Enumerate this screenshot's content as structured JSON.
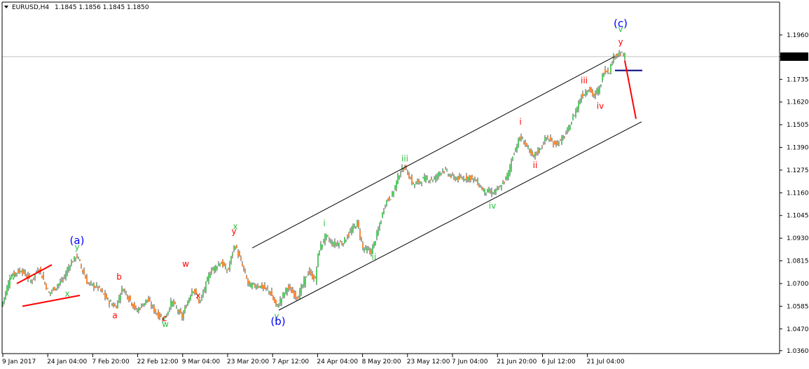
{
  "chart_data": {
    "type": "candlestick",
    "header": {
      "symbol_timeframe": "EURUSD,H4",
      "ohlc": "1.1845 1.1856 1.1845 1.1850"
    },
    "ylim": [
      1.0345,
      1.202
    ],
    "y_ticks": [
      "1.1960",
      "1.1850",
      "1.1735",
      "1.1620",
      "1.1505",
      "1.1390",
      "1.1275",
      "1.1160",
      "1.1045",
      "1.0930",
      "1.0815",
      "1.0700",
      "1.0585",
      "1.0470",
      "1.0360"
    ],
    "current_price": "1.1850",
    "x_ticks": [
      "9 Jan 2017",
      "24 Jan 04:00",
      "7 Feb 20:00",
      "22 Feb 12:00",
      "9 Mar 04:00",
      "23 Mar 20:00",
      "7 Apr 12:00",
      "24 Apr 04:00",
      "8 May 20:00",
      "23 May 12:00",
      "7 Jun 04:00",
      "21 Jun 20:00",
      "6 Jul 12:00",
      "21 Jul 04:00"
    ],
    "path": [
      [
        0,
        1.056
      ],
      [
        15,
        1.074
      ],
      [
        30,
        1.077
      ],
      [
        45,
        1.071
      ],
      [
        55,
        1.078
      ],
      [
        70,
        1.065
      ],
      [
        90,
        1.072
      ],
      [
        100,
        1.08
      ],
      [
        110,
        1.084
      ],
      [
        125,
        1.07
      ],
      [
        140,
        1.068
      ],
      [
        155,
        1.061
      ],
      [
        165,
        1.058
      ],
      [
        175,
        1.068
      ],
      [
        185,
        1.062
      ],
      [
        195,
        1.056
      ],
      [
        210,
        1.062
      ],
      [
        225,
        1.054
      ],
      [
        235,
        1.052
      ],
      [
        245,
        1.061
      ],
      [
        260,
        1.053
      ],
      [
        275,
        1.068
      ],
      [
        285,
        1.06
      ],
      [
        300,
        1.076
      ],
      [
        315,
        1.081
      ],
      [
        325,
        1.076
      ],
      [
        335,
        1.09
      ],
      [
        345,
        1.08
      ],
      [
        355,
        1.069
      ],
      [
        370,
        1.069
      ],
      [
        385,
        1.066
      ],
      [
        395,
        1.058
      ],
      [
        410,
        1.068
      ],
      [
        425,
        1.063
      ],
      [
        440,
        1.076
      ],
      [
        450,
        1.072
      ],
      [
        455,
        1.087
      ],
      [
        465,
        1.094
      ],
      [
        475,
        1.09
      ],
      [
        490,
        1.091
      ],
      [
        500,
        1.096
      ],
      [
        510,
        1.101
      ],
      [
        518,
        1.088
      ],
      [
        530,
        1.086
      ],
      [
        540,
        1.097
      ],
      [
        550,
        1.111
      ],
      [
        560,
        1.115
      ],
      [
        570,
        1.126
      ],
      [
        578,
        1.129
      ],
      [
        590,
        1.12
      ],
      [
        605,
        1.123
      ],
      [
        620,
        1.123
      ],
      [
        632,
        1.128
      ],
      [
        645,
        1.124
      ],
      [
        655,
        1.123
      ],
      [
        670,
        1.124
      ],
      [
        680,
        1.122
      ],
      [
        690,
        1.117
      ],
      [
        705,
        1.116
      ],
      [
        715,
        1.119
      ],
      [
        725,
        1.125
      ],
      [
        732,
        1.135
      ],
      [
        742,
        1.144
      ],
      [
        750,
        1.141
      ],
      [
        760,
        1.134
      ],
      [
        770,
        1.138
      ],
      [
        780,
        1.144
      ],
      [
        790,
        1.141
      ],
      [
        800,
        1.142
      ],
      [
        810,
        1.147
      ],
      [
        820,
        1.156
      ],
      [
        830,
        1.165
      ],
      [
        840,
        1.169
      ],
      [
        848,
        1.165
      ],
      [
        856,
        1.169
      ],
      [
        862,
        1.178
      ],
      [
        870,
        1.178
      ],
      [
        876,
        1.185
      ],
      [
        882,
        1.187
      ],
      [
        888,
        1.186
      ],
      [
        893,
        1.185
      ]
    ],
    "wave_labels": [
      {
        "text": "w",
        "color": "#2ec03f",
        "x": 17,
        "y": 1.072
      },
      {
        "text": "x",
        "color": "#2ec03f",
        "x": 96,
        "y": 1.0635
      },
      {
        "text": "(a)",
        "color": "#0000ff",
        "x": 110,
        "y": 1.09,
        "big": true
      },
      {
        "text": "y",
        "color": "#2ec03f",
        "x": 110,
        "y": 1.087
      },
      {
        "text": "b",
        "color": "#ff0000",
        "x": 170,
        "y": 1.072
      },
      {
        "text": "a",
        "color": "#ff0000",
        "x": 164,
        "y": 1.0525
      },
      {
        "text": "c",
        "color": "#ff0000",
        "x": 235,
        "y": 1.051
      },
      {
        "text": "w",
        "color": "#2ec03f",
        "x": 236,
        "y": 1.048
      },
      {
        "text": "w",
        "color": "#ff0000",
        "x": 265,
        "y": 1.0785
      },
      {
        "text": "x",
        "color": "#ff0000",
        "x": 283,
        "y": 1.0625
      },
      {
        "text": "x",
        "color": "#2ec03f",
        "x": 336,
        "y": 1.0975
      },
      {
        "text": "y",
        "color": "#ff0000",
        "x": 334,
        "y": 1.095
      },
      {
        "text": "y",
        "color": "#2ec03f",
        "x": 395,
        "y": 1.052
      },
      {
        "text": "(b)",
        "color": "#0000ff",
        "x": 397,
        "y": 1.049,
        "big": true
      },
      {
        "text": "i",
        "color": "#2ec03f",
        "x": 463,
        "y": 1.099
      },
      {
        "text": "ii",
        "color": "#2ec03f",
        "x": 534,
        "y": 1.082
      },
      {
        "text": "iii",
        "color": "#2ec03f",
        "x": 578,
        "y": 1.132
      },
      {
        "text": "iv",
        "color": "#2ec03f",
        "x": 703,
        "y": 1.108
      },
      {
        "text": "i",
        "color": "#ff0000",
        "x": 743,
        "y": 1.1505
      },
      {
        "text": "ii",
        "color": "#ff0000",
        "x": 764,
        "y": 1.1285
      },
      {
        "text": "iii",
        "color": "#ff0000",
        "x": 834,
        "y": 1.1715
      },
      {
        "text": "iv",
        "color": "#ff0000",
        "x": 857,
        "y": 1.1585
      },
      {
        "text": "v",
        "color": "#2ec03f",
        "x": 886,
        "y": 1.1975
      },
      {
        "text": "(c)",
        "color": "#0000ff",
        "x": 886,
        "y": 1.2,
        "big": true
      },
      {
        "text": "y",
        "color": "#ff0000",
        "x": 886,
        "y": 1.191
      }
    ],
    "channel_lines": [
      {
        "color": "#000000",
        "x1": 360,
        "y1": 1.088,
        "x2": 877,
        "y2": 1.185
      },
      {
        "color": "#000000",
        "x1": 398,
        "y1": 1.0565,
        "x2": 916,
        "y2": 1.152
      },
      {
        "color": "#ff0000",
        "x1": 24,
        "y1": 1.07,
        "x2": 74,
        "y2": 1.0795
      },
      {
        "color": "#ff0000",
        "x1": 32,
        "y1": 1.0585,
        "x2": 114,
        "y2": 1.064
      },
      {
        "color": "#000080",
        "x1": 878,
        "y1": 1.178,
        "x2": 917,
        "y2": 1.178
      },
      {
        "color": "#ff0000",
        "x1": 892,
        "y1": 1.183,
        "x2": 908,
        "y2": 1.1535
      }
    ],
    "colors": {
      "bull": "#2ec03f",
      "bear": "#ff6a00",
      "wick": "#000000",
      "price_line": "#c0c0c0",
      "price_box": "#000000",
      "price_text": "#ffffff"
    }
  }
}
